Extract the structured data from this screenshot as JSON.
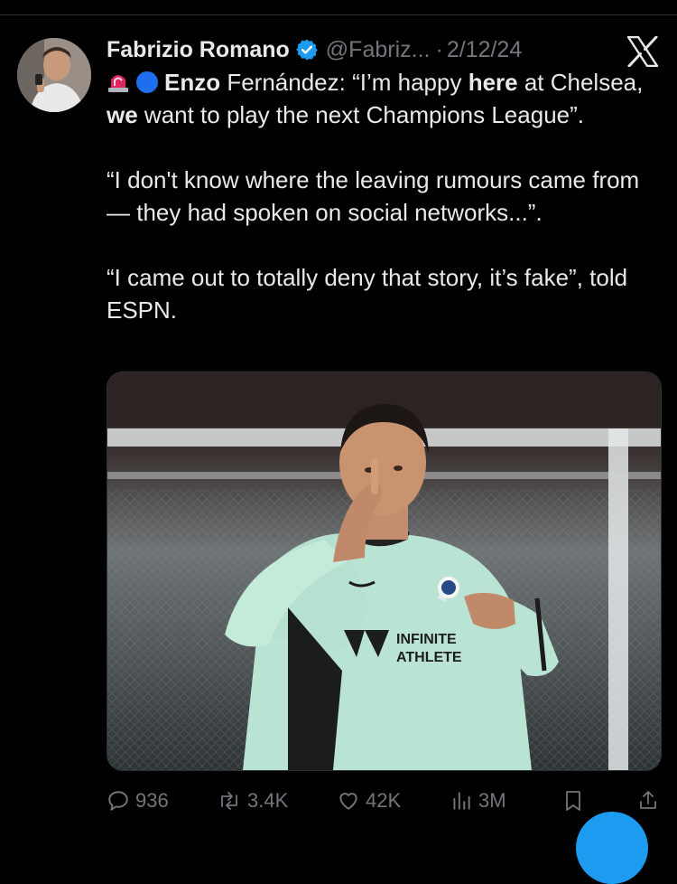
{
  "author": {
    "name": "Fabrizio Romano",
    "handle": "@Fabriz...",
    "separator": "·",
    "date": "2/12/24",
    "verified": true,
    "avatar_icon": "user-avatar"
  },
  "tweet": {
    "lead_emojis": [
      "siren-emoji",
      "blue-circle-emoji"
    ],
    "line1": {
      "b1": "Enzo",
      "t1": " Fernández: “I’m happy ",
      "b2": "here",
      "t2": " at Chelsea, ",
      "b3": "we",
      "t3": " want to play the next Champions League”."
    },
    "paragraph2": "“I don't know where the leaving rumours came from — they had spoken on social networks...”.",
    "paragraph3": "“I came out to totally deny that story, it’s fake”, told ESPN."
  },
  "media": {
    "kit_text_1": "INFINITE",
    "kit_text_2": "ATHLETE"
  },
  "actions": {
    "replies": "936",
    "reposts": "3.4K",
    "likes": "42K",
    "views": "3M"
  },
  "colors": {
    "background": "#000000",
    "text": "#e7e9ea",
    "muted": "#71767b",
    "verified": "#1d9bf0"
  }
}
